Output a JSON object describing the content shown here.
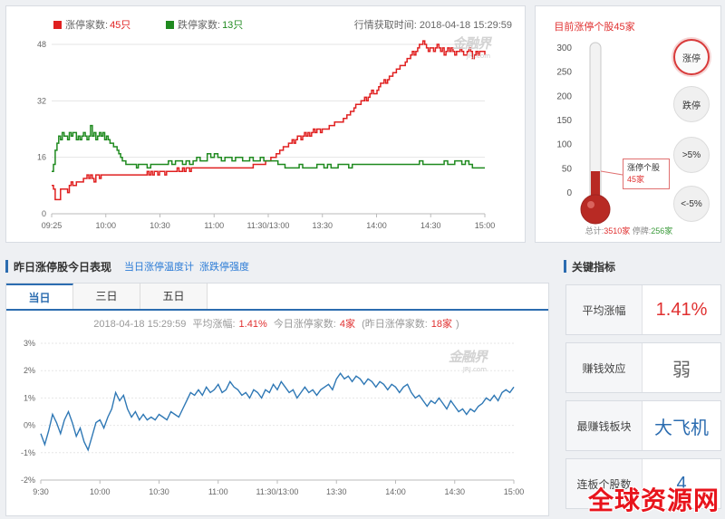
{
  "top_chart": {
    "legend_limit_up_label": "涨停家数:",
    "legend_limit_up_value": "45只",
    "legend_limit_down_label": "跌停家数:",
    "legend_limit_down_value": "13只",
    "fetch_time": "行情获取时间: 2018-04-18 15:29:59",
    "watermark": "金融界",
    "watermark_sub": "JRJ.com",
    "colors": {
      "limit_up": "#e02020",
      "limit_down": "#1f8a1f"
    }
  },
  "chart_data": [
    {
      "type": "line",
      "ylim": [
        0,
        48
      ],
      "yticks": [
        "0",
        "16",
        "32",
        "48"
      ],
      "xticks": [
        "09:25",
        "10:00",
        "10:30",
        "11:00",
        "11:30/13:00",
        "13:30",
        "14:00",
        "14:30",
        "15:00"
      ],
      "series": [
        {
          "name": "涨停家数",
          "color": "#e02020",
          "x": [
            0,
            1,
            2,
            3,
            5,
            7,
            9,
            10,
            11,
            12,
            14,
            16,
            18,
            19,
            20,
            21,
            22,
            23,
            24,
            25,
            26,
            27,
            28,
            29,
            30,
            31,
            32,
            33,
            34,
            35,
            36,
            37,
            38,
            39,
            40,
            41,
            42,
            43,
            44,
            45,
            46,
            47,
            48,
            49,
            50,
            51,
            52,
            53,
            54,
            55,
            56,
            57,
            58,
            59,
            60,
            61,
            62,
            63,
            64,
            65,
            66,
            67,
            68,
            69,
            70,
            71,
            72,
            73,
            74,
            75,
            76,
            77,
            78,
            79,
            80,
            81,
            82,
            83,
            84,
            85,
            86,
            87,
            88,
            89,
            90,
            91,
            92,
            93,
            94,
            95,
            96,
            97,
            98,
            99,
            100,
            101,
            102,
            103,
            104,
            105,
            106,
            107,
            108,
            109,
            110,
            111,
            112,
            113,
            114,
            115,
            116,
            117,
            118,
            119,
            120,
            121,
            122,
            123,
            124,
            125,
            126,
            127,
            128,
            129,
            130,
            131,
            132,
            133,
            134,
            135,
            136,
            137,
            138,
            139,
            140,
            141,
            142,
            143,
            144,
            145,
            146,
            147,
            148,
            149,
            150,
            151,
            152,
            153,
            154,
            155,
            156,
            157,
            158,
            159,
            160,
            161,
            162,
            163,
            164,
            165,
            166,
            167,
            168,
            169,
            170,
            171,
            172,
            173,
            174,
            175,
            176,
            177,
            178,
            179,
            180,
            181,
            182,
            183,
            184,
            185,
            186,
            187,
            188,
            189,
            190,
            191,
            192,
            193,
            194,
            195,
            196,
            197,
            198,
            199,
            200,
            201,
            202,
            203,
            204,
            205,
            206,
            207,
            208,
            209,
            210,
            211,
            212,
            213,
            214,
            215,
            216,
            217,
            218,
            219,
            220,
            221,
            222,
            223,
            224,
            225,
            226,
            227,
            228,
            229,
            230,
            231,
            232,
            233,
            234,
            235,
            236,
            237,
            238,
            239,
            240,
            241,
            242,
            243,
            244,
            245
          ],
          "y": [
            8,
            7,
            4,
            4,
            7,
            7,
            6,
            8,
            9,
            8,
            9,
            9,
            10,
            10,
            11,
            10,
            11,
            10,
            9,
            11,
            11,
            10,
            11,
            11,
            11,
            11,
            11,
            11,
            11,
            11,
            11,
            11,
            11,
            11,
            11,
            11,
            11,
            11,
            11,
            11,
            11,
            11,
            11,
            11,
            11,
            11,
            11,
            11,
            12,
            11,
            12,
            11,
            12,
            12,
            11,
            12,
            12,
            12,
            11,
            12,
            12,
            12,
            12,
            12,
            12,
            13,
            12,
            12,
            13,
            12,
            13,
            13,
            12,
            13,
            13,
            13,
            13,
            13,
            13,
            13,
            13,
            13,
            13,
            13,
            13,
            13,
            13,
            13,
            13,
            13,
            13,
            13,
            13,
            13,
            13,
            13,
            13,
            13,
            13,
            13,
            13,
            13,
            13,
            13,
            13,
            13,
            13,
            13,
            14,
            14,
            14,
            14,
            14,
            14,
            14,
            15,
            15,
            15,
            16,
            16,
            16,
            17,
            17,
            18,
            18,
            19,
            19,
            19,
            20,
            20,
            21,
            20,
            21,
            22,
            22,
            21,
            22,
            23,
            22,
            23,
            22,
            23,
            24,
            23,
            24,
            24,
            23,
            24,
            24,
            24,
            24,
            25,
            25,
            25,
            26,
            26,
            26,
            26,
            26,
            27,
            27,
            28,
            28,
            29,
            29,
            30,
            31,
            31,
            31,
            32,
            32,
            33,
            32,
            33,
            34,
            35,
            34,
            34,
            35,
            36,
            37,
            37,
            38,
            37,
            38,
            39,
            39,
            40,
            40,
            41,
            41,
            42,
            42,
            42,
            43,
            44,
            44,
            45,
            46,
            45,
            46,
            47,
            48,
            48,
            49,
            48,
            47,
            46,
            47,
            47,
            46,
            47,
            48,
            47,
            46,
            47,
            45,
            46,
            47,
            46,
            47,
            46,
            45,
            46,
            46,
            47,
            46,
            45,
            45,
            46,
            47,
            46,
            44,
            45,
            46,
            45,
            46,
            46,
            46,
            45
          ]
        },
        {
          "name": "跌停家数",
          "color": "#1f8a1f",
          "x": [
            0,
            1,
            2,
            3,
            4,
            5,
            6,
            7,
            8,
            9,
            10,
            11,
            12,
            13,
            14,
            15,
            16,
            17,
            18,
            19,
            20,
            21,
            22,
            23,
            24,
            25,
            26,
            27,
            28,
            29,
            30,
            31,
            32,
            33,
            34,
            35,
            36,
            37,
            38,
            39,
            40,
            41,
            42,
            43,
            44,
            45,
            46,
            47,
            48,
            49,
            50,
            52,
            54,
            56,
            58,
            60,
            62,
            64,
            66,
            68,
            70,
            72,
            74,
            76,
            78,
            80,
            82,
            84,
            86,
            88,
            90,
            92,
            94,
            96,
            98,
            100,
            102,
            104,
            106,
            108,
            110,
            112,
            114,
            116,
            118,
            120,
            122,
            124,
            126,
            128,
            130,
            132,
            134,
            136,
            138,
            140,
            142,
            144,
            146,
            148,
            150,
            152,
            154,
            156,
            158,
            160,
            162,
            164,
            166,
            168,
            170,
            172,
            174,
            176,
            178,
            180,
            182,
            184,
            186,
            188,
            190,
            192,
            194,
            196,
            198,
            200,
            202,
            204,
            206,
            208,
            210,
            212,
            214,
            216,
            218,
            220,
            222,
            224,
            226,
            228,
            230,
            232,
            234,
            236,
            238,
            240,
            242,
            245
          ],
          "y": [
            12,
            14,
            18,
            20,
            22,
            21,
            23,
            22,
            22,
            21,
            23,
            22,
            23,
            23,
            21,
            22,
            21,
            22,
            23,
            22,
            21,
            22,
            25,
            22,
            23,
            21,
            22,
            23,
            22,
            23,
            21,
            22,
            21,
            20,
            20,
            19,
            19,
            18,
            17,
            16,
            15,
            15,
            14,
            14,
            14,
            14,
            14,
            14,
            13,
            14,
            14,
            14,
            13,
            14,
            14,
            14,
            14,
            14,
            15,
            14,
            15,
            15,
            14,
            15,
            14,
            15,
            16,
            15,
            15,
            17,
            16,
            17,
            16,
            15,
            16,
            16,
            15,
            16,
            16,
            15,
            15,
            16,
            15,
            15,
            16,
            15,
            15,
            15,
            15,
            14,
            14,
            13,
            13,
            13,
            13,
            14,
            13,
            13,
            13,
            13,
            14,
            14,
            13,
            14,
            13,
            13,
            14,
            14,
            14,
            13,
            14,
            14,
            14,
            14,
            14,
            14,
            14,
            14,
            14,
            14,
            14,
            14,
            14,
            14,
            14,
            14,
            14,
            14,
            14,
            15,
            14,
            14,
            14,
            14,
            14,
            14,
            15,
            14,
            14,
            15,
            15,
            14,
            15,
            14,
            13,
            13,
            13,
            13
          ]
        }
      ]
    },
    {
      "type": "line",
      "ylim": [
        -2,
        3
      ],
      "yticks": [
        "-2%",
        "-1%",
        "0%",
        "1%",
        "2%",
        "3%"
      ],
      "xticks": [
        "9:30",
        "10:00",
        "10:30",
        "11:00",
        "11:30/13:00",
        "13:30",
        "14:00",
        "14:30",
        "15:00"
      ],
      "series": [
        {
          "color": "#2f78b5",
          "x": [
            0,
            2,
            4,
            6,
            8,
            10,
            12,
            14,
            16,
            18,
            20,
            22,
            24,
            26,
            28,
            30,
            32,
            34,
            36,
            38,
            40,
            42,
            44,
            46,
            48,
            50,
            52,
            54,
            56,
            58,
            60,
            62,
            64,
            66,
            68,
            70,
            72,
            74,
            76,
            78,
            80,
            82,
            84,
            86,
            88,
            90,
            92,
            94,
            96,
            98,
            100,
            102,
            104,
            106,
            108,
            110,
            112,
            114,
            116,
            118,
            120,
            122,
            124,
            126,
            128,
            130,
            132,
            134,
            136,
            138,
            140,
            142,
            144,
            146,
            148,
            150,
            152,
            154,
            156,
            158,
            160,
            162,
            164,
            166,
            168,
            170,
            172,
            174,
            176,
            178,
            180,
            182,
            184,
            186,
            188,
            190,
            192,
            194,
            196,
            198,
            200,
            202,
            204,
            206,
            208,
            210,
            212,
            214,
            216,
            218,
            220,
            222,
            224,
            226,
            228,
            230,
            232,
            234,
            236,
            238,
            240
          ],
          "y": [
            -0.3,
            -0.7,
            -0.2,
            0.4,
            0.1,
            -0.3,
            0.2,
            0.5,
            0.1,
            -0.4,
            -0.1,
            -0.6,
            -0.9,
            -0.4,
            0.1,
            0.2,
            -0.1,
            0.3,
            0.6,
            1.2,
            0.9,
            1.1,
            0.6,
            0.3,
            0.5,
            0.2,
            0.4,
            0.2,
            0.3,
            0.2,
            0.4,
            0.3,
            0.2,
            0.5,
            0.4,
            0.3,
            0.6,
            0.9,
            1.2,
            1.1,
            1.3,
            1.1,
            1.4,
            1.2,
            1.3,
            1.5,
            1.2,
            1.3,
            1.6,
            1.4,
            1.3,
            1.1,
            1.2,
            1.0,
            1.3,
            1.2,
            1.0,
            1.3,
            1.2,
            1.5,
            1.3,
            1.6,
            1.4,
            1.2,
            1.3,
            1.0,
            1.2,
            1.4,
            1.2,
            1.3,
            1.1,
            1.3,
            1.4,
            1.5,
            1.3,
            1.7,
            1.9,
            1.7,
            1.8,
            1.6,
            1.8,
            1.7,
            1.5,
            1.7,
            1.6,
            1.4,
            1.6,
            1.5,
            1.3,
            1.5,
            1.4,
            1.2,
            1.4,
            1.5,
            1.2,
            1.0,
            1.1,
            0.9,
            0.7,
            0.9,
            0.8,
            1.0,
            0.8,
            0.6,
            0.9,
            0.7,
            0.5,
            0.6,
            0.4,
            0.6,
            0.5,
            0.7,
            0.8,
            1.0,
            0.9,
            1.1,
            0.9,
            1.2,
            1.3,
            1.2,
            1.4
          ]
        }
      ]
    }
  ],
  "thermometer": {
    "title": "目前涨停个股45家",
    "scale": [
      "300",
      "250",
      "200",
      "150",
      "100",
      "50",
      "0"
    ],
    "level_value": 45,
    "level_max": 300,
    "buttons": [
      "涨停",
      "跌停",
      ">5%",
      "<-5%"
    ],
    "tooltip_label": "涨停个股",
    "tooltip_value": "45家",
    "total_label": "总计:",
    "total_value": "3510家",
    "suspended_label": "停牌:",
    "suspended_value": "256家"
  },
  "bottom": {
    "title": "昨日涨停股今日表现",
    "link1": "当日涨停温度计",
    "link2": "涨跌停强度",
    "tabs": [
      "当日",
      "三日",
      "五日"
    ],
    "info_time": "2018-04-18 15:29:59",
    "info_avg_label": "平均涨幅:",
    "info_avg_value": "1.41%",
    "info_today_label": "今日涨停家数:",
    "info_today_value": "4家",
    "info_yest_label": "(昨日涨停家数:",
    "info_yest_value": "18家",
    "info_close": ")"
  },
  "key_metrics": {
    "title": "关键指标",
    "items": [
      {
        "label": "平均涨幅",
        "value": "1.41%"
      },
      {
        "label": "赚钱效应",
        "value": "弱"
      },
      {
        "label": "最赚钱板块",
        "value": "大飞机"
      },
      {
        "label": "连板个股数",
        "value": "4"
      }
    ]
  },
  "site_watermark": "全球资源网"
}
